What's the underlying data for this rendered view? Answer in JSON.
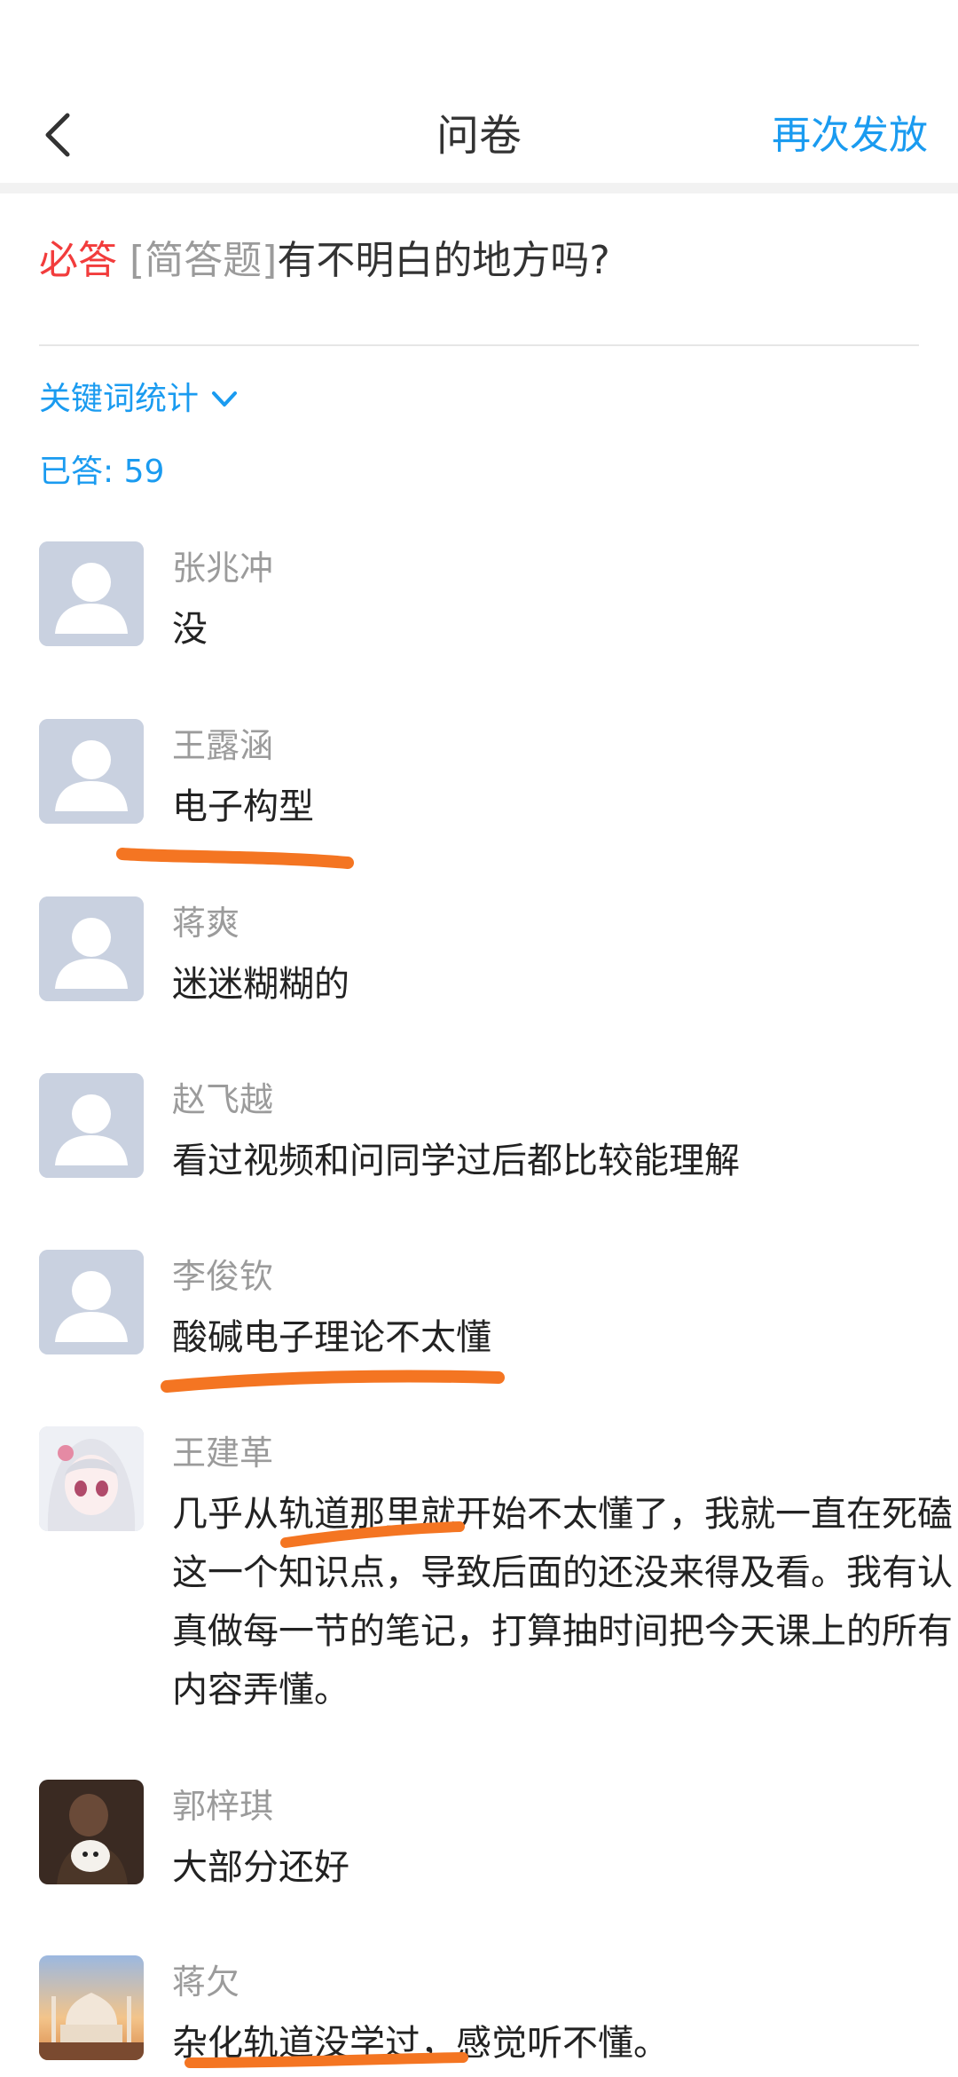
{
  "nav": {
    "back_icon": "chevron-left-icon",
    "title": "问卷",
    "action": "再次发放"
  },
  "question": {
    "required": "必答",
    "type": "[简答题]",
    "text": "有不明白的地方吗?"
  },
  "keywords": {
    "label": "关键词统计",
    "icon": "chevron-down-icon"
  },
  "answered": "已答: 59",
  "colors": {
    "accent": "#1a9bf0",
    "required": "#f23c3c",
    "annotation": "#f47522"
  },
  "responses": [
    {
      "name": "张兆冲",
      "text": "没",
      "avatar": "default"
    },
    {
      "name": "王露涵",
      "text": "电子构型",
      "avatar": "default"
    },
    {
      "name": "蒋爽",
      "text": "迷迷糊糊的",
      "avatar": "default"
    },
    {
      "name": "赵飞越",
      "text": "看过视频和问同学过后都比较能理解",
      "avatar": "default"
    },
    {
      "name": "李俊钦",
      "text": "酸碱电子理论不太懂",
      "avatar": "default"
    },
    {
      "name": "王建革",
      "text": "几乎从轨道那里就开始不太懂了，我就一直在死磕这一个知识点，导致后面的还没来得及看。我有认真做每一节的笔记，打算抽时间把今天课上的所有内容弄懂。",
      "avatar": "anime"
    },
    {
      "name": "郭梓琪",
      "text": "大部分还好",
      "avatar": "photo-dog"
    },
    {
      "name": "蒋欠",
      "text": "杂化轨道没学过，感觉听不懂。",
      "avatar": "photo-building"
    }
  ]
}
